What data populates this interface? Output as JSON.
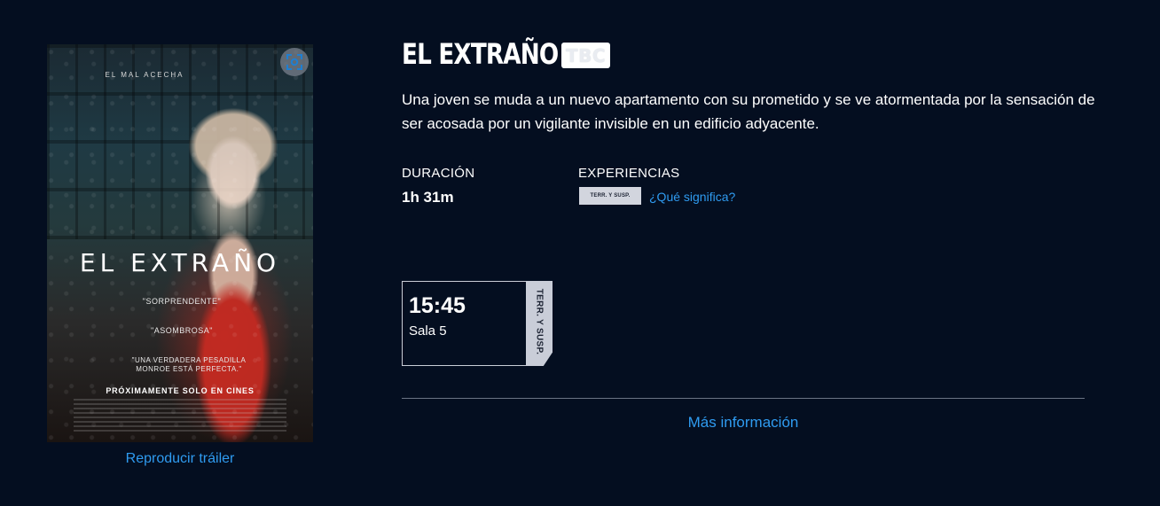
{
  "poster": {
    "tagline": "EL MAL ACECHA",
    "title": "EL EXTRAÑO",
    "quote1": "\"SORPRENDENTE\"",
    "quote2": "\"ASOMBROSA\"",
    "quote3": "\"UNA VERDADERA PESADILLA MONROE ESTÁ PERFECTA.\"",
    "release": "PRÓXIMAMENTE SOLO EN CINES"
  },
  "trailer_link": "Reproducir tráiler",
  "movie": {
    "title": "EL EXTRAÑO",
    "rating": "TBC",
    "synopsis": "Una joven se muda a un nuevo apartamento con su prometido y se ve atormentada por la sensación de ser acosada por un vigilante invisible en un edificio adyacente.",
    "duration_label": "DURACIÓN",
    "duration_value": "1h 31m",
    "experiences_label": "EXPERIENCIAS",
    "experience_chip": "TERR. Y SUSP.",
    "experience_help": "¿Qué significa?"
  },
  "showtimes": [
    {
      "time": "15:45",
      "room": "Sala 5",
      "tag": "TERR. Y SUSP."
    }
  ],
  "more_info": "Más información",
  "colors": {
    "background": "#040e20",
    "link": "#2f9bf0",
    "chip": "#d2d5de"
  },
  "icons": {
    "zoom": "zoom-fullscreen-icon"
  }
}
